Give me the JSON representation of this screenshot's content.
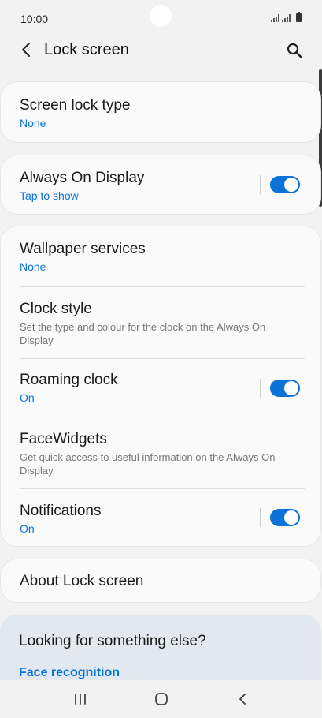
{
  "status_bar": {
    "time": "10:00"
  },
  "header": {
    "title": "Lock screen"
  },
  "cards": {
    "screen_lock": {
      "title": "Screen lock type",
      "value": "None"
    },
    "aod": {
      "title": "Always On Display",
      "value": "Tap to show",
      "toggle_on": true
    },
    "group": {
      "wallpaper": {
        "title": "Wallpaper services",
        "value": "None"
      },
      "clock_style": {
        "title": "Clock style",
        "desc": "Set the type and colour for the clock on the Always On Display."
      },
      "roaming_clock": {
        "title": "Roaming clock",
        "value": "On",
        "toggle_on": true
      },
      "facewidgets": {
        "title": "FaceWidgets",
        "desc": "Get quick access to useful information on the Always On Display."
      },
      "notifications": {
        "title": "Notifications",
        "value": "On",
        "toggle_on": true
      }
    },
    "about": {
      "title": "About Lock screen"
    }
  },
  "suggestions": {
    "title": "Looking for something else?",
    "link": "Face recognition"
  },
  "colors": {
    "accent": "#0a73d9",
    "background": "#f2f2f2",
    "card": "#fafafa",
    "suggest_bg": "#e1e8ef"
  },
  "icons": {
    "back": "chevron-left-icon",
    "search": "search-icon",
    "recents": "recents-icon",
    "home": "home-icon",
    "nav_back": "nav-back-icon"
  }
}
